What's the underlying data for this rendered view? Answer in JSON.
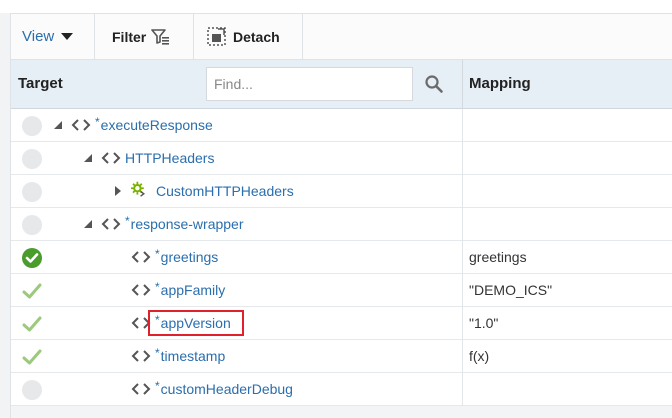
{
  "toolbar": {
    "view_label": "View",
    "filter_label": "Filter",
    "detach_label": "Detach"
  },
  "header": {
    "target_label": "Target",
    "find_placeholder": "Find...",
    "mapping_label": "Mapping"
  },
  "rows": [
    {
      "name": "executeResponse",
      "required": true,
      "status": "empty",
      "expander": "expanded",
      "icon": "element-icon",
      "mapping": ""
    },
    {
      "name": "HTTPHeaders",
      "required": false,
      "status": "empty",
      "expander": "expanded",
      "icon": "element-icon",
      "mapping": ""
    },
    {
      "name": "CustomHTTPHeaders",
      "required": false,
      "status": "empty",
      "expander": "collapsed",
      "icon": "gear-element-icon",
      "mapping": ""
    },
    {
      "name": "response-wrapper",
      "required": true,
      "status": "empty",
      "expander": "expanded",
      "icon": "element-icon",
      "mapping": ""
    },
    {
      "name": "greetings",
      "required": true,
      "status": "complete-circle",
      "expander": "none",
      "icon": "element-icon",
      "mapping": "greetings"
    },
    {
      "name": "appFamily",
      "required": true,
      "status": "check",
      "expander": "none",
      "icon": "element-icon",
      "mapping": "\"DEMO_ICS\""
    },
    {
      "name": "appVersion",
      "required": true,
      "status": "check",
      "expander": "none",
      "icon": "element-icon",
      "mapping": "\"1.0\"",
      "highlighted": true
    },
    {
      "name": "timestamp",
      "required": true,
      "status": "check",
      "expander": "none",
      "icon": "element-icon",
      "mapping": "f(x)"
    },
    {
      "name": "customHeaderDebug",
      "required": true,
      "status": "empty",
      "expander": "none",
      "icon": "element-icon",
      "mapping": ""
    }
  ],
  "required_marker": "*",
  "colors": {
    "link": "#2a6ead",
    "header_bg": "#e6eef6",
    "check_green": "#4a9c2d",
    "highlight_red": "#e0202a"
  }
}
